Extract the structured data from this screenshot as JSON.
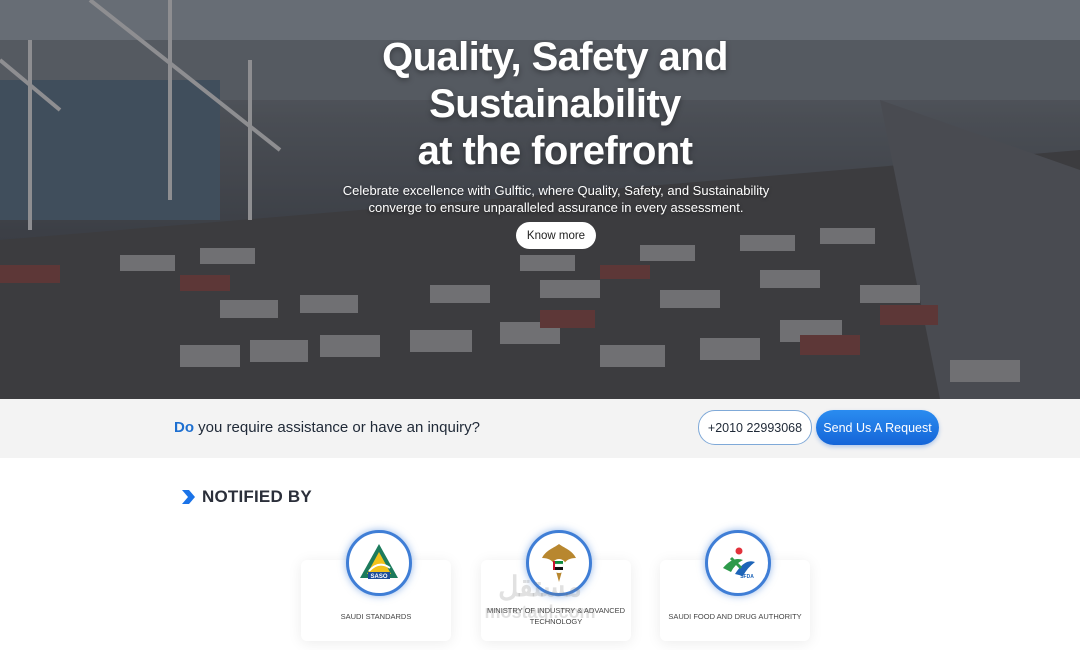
{
  "hero": {
    "title_lines": [
      "Quality, Safety and",
      "Sustainability",
      "at the forefront"
    ],
    "subtitle_lines": [
      "Celebrate excellence with Gulftic, where Quality, Safety, and Sustainability",
      "converge to ensure unparalleled assurance in every assessment."
    ],
    "cta_label": "Know more"
  },
  "inquiry": {
    "accent_word": "Do",
    "rest": "you require assistance or have an inquiry?",
    "phone": "+2010 22993068",
    "request_label": "Send Us A Request"
  },
  "notified": {
    "title": "NOTIFIED BY",
    "authorities": [
      {
        "label": "SAUDI STANDARDS",
        "logo_text": "SASO",
        "icon": "saso-logo-icon"
      },
      {
        "label": "MINISTRY OF INDUSTRY & ADVANCED TECHNOLOGY",
        "icon": "uae-emblem-icon"
      },
      {
        "label": "SAUDI FOOD AND DRUG AUTHORITY",
        "logo_text": "SFDA",
        "icon": "sfda-logo-icon"
      }
    ]
  },
  "watermark": {
    "arabic": "مستقل",
    "latin": "mostaql.com"
  },
  "colors": {
    "accent": "#1d6fd0",
    "button_blue": "#1a73e8",
    "logo_ring": "#3f7ed6"
  }
}
